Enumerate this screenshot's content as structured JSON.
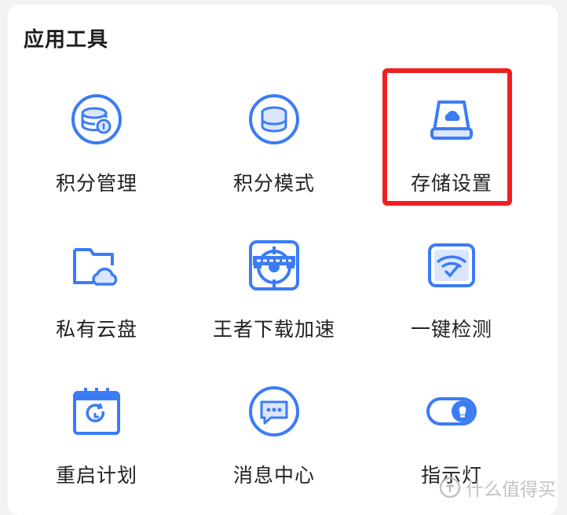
{
  "section": {
    "title": "应用工具"
  },
  "tools": [
    {
      "label": "积分管理",
      "icon": "points-coin-database-icon"
    },
    {
      "label": "积分模式",
      "icon": "database-icon"
    },
    {
      "label": "存储设置",
      "icon": "cloud-drive-icon",
      "highlighted": true
    },
    {
      "label": "私有云盘",
      "icon": "folder-cloud-icon"
    },
    {
      "label": "王者下载加速",
      "icon": "game-accelerator-icon"
    },
    {
      "label": "一键检测",
      "icon": "wifi-check-icon"
    },
    {
      "label": "重启计划",
      "icon": "calendar-restart-icon"
    },
    {
      "label": "消息中心",
      "icon": "chat-message-icon"
    },
    {
      "label": "指示灯",
      "icon": "bulb-toggle-icon"
    }
  ],
  "watermark": {
    "text": "什么值得买"
  },
  "colors": {
    "accent": "#3b7cf5",
    "highlight": "#f01f1f",
    "icon_fill": "#dbe6fd"
  }
}
